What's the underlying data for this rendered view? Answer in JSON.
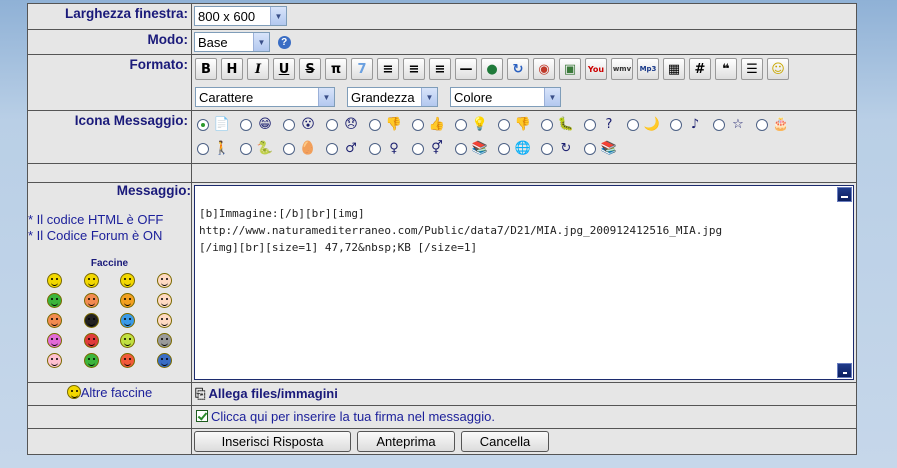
{
  "labels": {
    "width": "Larghezza finestra:",
    "mode": "Modo:",
    "format": "Formato:",
    "icon": "Icona Messaggio:",
    "message": "Messaggio:"
  },
  "width_select": {
    "value": "800 x 600"
  },
  "mode_select": {
    "value": "Base",
    "help": "?"
  },
  "format_toolbar": {
    "buttons": [
      "B",
      "H",
      "I",
      "U",
      "S",
      "π",
      "7",
      "≡",
      "≡",
      "≡",
      "—",
      "●",
      "↻",
      "◉",
      "▣",
      "You",
      "wmv",
      "Mp3",
      "▦",
      "#",
      "❝",
      "☰",
      "☺"
    ],
    "selects": [
      {
        "value": "Carattere"
      },
      {
        "value": "Grandezza"
      },
      {
        "value": "Colore"
      }
    ]
  },
  "message_icons": {
    "row1": [
      "📄",
      "😁",
      "😮",
      "😞",
      "👎",
      "👍",
      "💡",
      "👎",
      "🐛",
      "?",
      "🌙",
      "♪",
      "☆",
      "🎂"
    ],
    "row2": [
      "🚶",
      "🐍",
      "🥚",
      "♂",
      "♀",
      "⚥",
      "📚",
      "🌐",
      "↻",
      "📚"
    ]
  },
  "message": {
    "info_html": "* Il codice HTML è OFF",
    "info_forum": "* Il Codice Forum è ON",
    "faccine_title": "Faccine",
    "smiley_colors": [
      "#f2d800",
      "#f2d800",
      "#f2d800",
      "#ffd9c2",
      "#3cb53c",
      "#f28a50",
      "#f2a020",
      "#ffd9c2",
      "#f28a50",
      "#222222",
      "#3a9ae8",
      "#ffd9c2",
      "#e26bd6",
      "#e03b3b",
      "#c0e040",
      "#9a9a9a",
      "#ffc0d0",
      "#3cb53c",
      "#f25a3a",
      "#3a6dc4"
    ],
    "text_lines": [
      "[b]Immagine:[/b][br][img]",
      "http://www.naturamediterraneo.com/Public/data7/D21/MIA.jpg_200912412516_MIA.jpg",
      "[/img][br][size=1] 47,72&nbsp;KB [/size=1]"
    ]
  },
  "more_faccine": "Altre faccine",
  "attach": "Allega files/immagini",
  "signature": "Clicca qui per inserire la tua firma nel messaggio.",
  "buttons": {
    "reply": "Inserisci Risposta",
    "preview": "Anteprima",
    "cancel": "Cancella"
  }
}
